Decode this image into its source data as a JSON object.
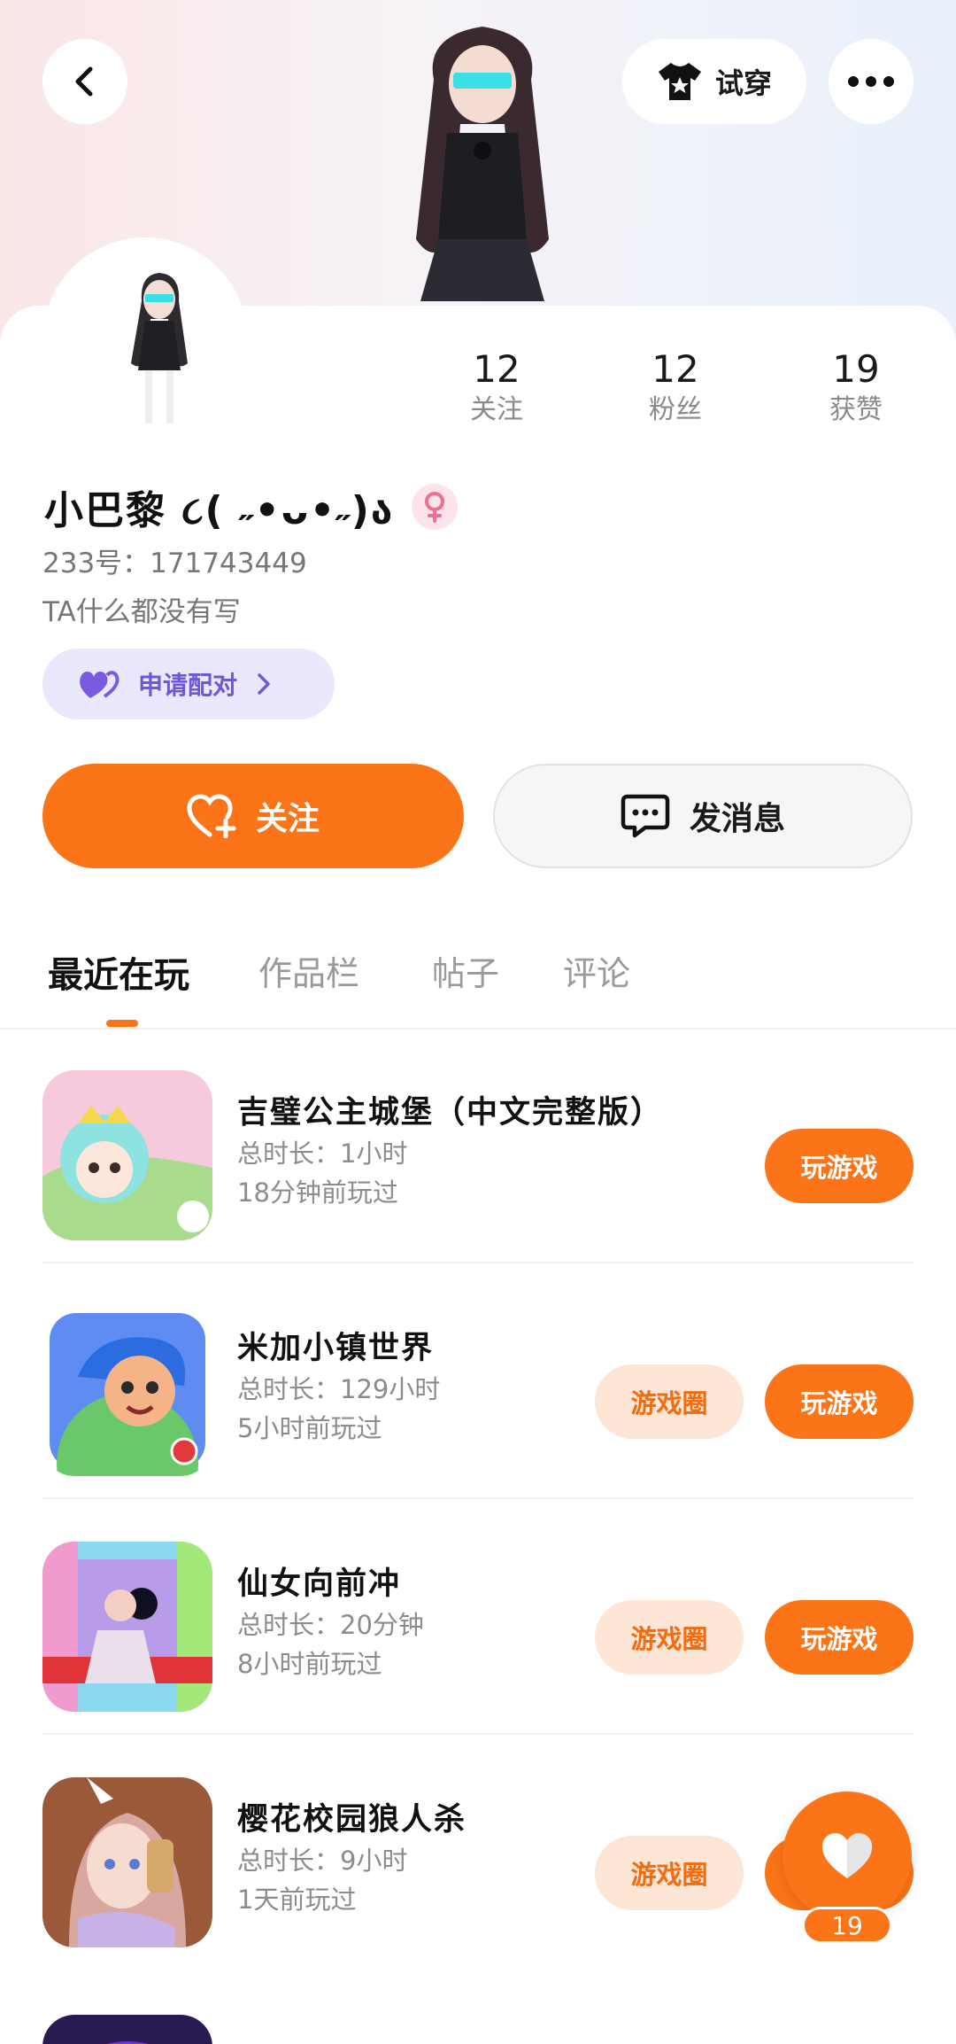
{
  "header": {
    "try_on_label": "试穿",
    "back_icon": "chevron-left-icon",
    "more_icon": "more-dots-icon",
    "shirt_icon": "tshirt-star-icon"
  },
  "profile": {
    "stats": [
      {
        "value": "12",
        "label": "关注"
      },
      {
        "value": "12",
        "label": "粉丝"
      },
      {
        "value": "19",
        "label": "获赞"
      }
    ],
    "name": "小巴黎 ૮( ˶•ᴗ•˶)ა",
    "gender": "female",
    "id_line": "233号：171743449",
    "bio": "TA什么都没有写",
    "pair_label": "申请配对",
    "follow_label": "关注",
    "message_label": "发消息"
  },
  "tabs": [
    {
      "label": "最近在玩",
      "active": true
    },
    {
      "label": "作品栏",
      "active": false
    },
    {
      "label": "帖子",
      "active": false
    },
    {
      "label": "评论",
      "active": false
    }
  ],
  "games": [
    {
      "title": "吉璧公主城堡（中文完整版）",
      "duration": "总时长：1小时",
      "last_played": "18分钟前玩过",
      "has_circle": false,
      "play_label": "玩游戏",
      "circle_label": ""
    },
    {
      "title": "米加小镇世界",
      "duration": "总时长：129小时",
      "last_played": "5小时前玩过",
      "has_circle": true,
      "play_label": "玩游戏",
      "circle_label": "游戏圈"
    },
    {
      "title": "仙女向前冲",
      "duration": "总时长：20分钟",
      "last_played": "8小时前玩过",
      "has_circle": true,
      "play_label": "玩游戏",
      "circle_label": "游戏圈"
    },
    {
      "title": "樱花校园狼人杀",
      "duration": "总时长：9小时",
      "last_played": "1天前玩过",
      "has_circle": true,
      "play_label": "玩游戏",
      "circle_label": "游戏圈"
    }
  ],
  "floating_like": {
    "count": "19"
  },
  "colors": {
    "accent": "#fb7418",
    "pair": "#6c58d8",
    "circle_bg": "#fde6d6"
  }
}
